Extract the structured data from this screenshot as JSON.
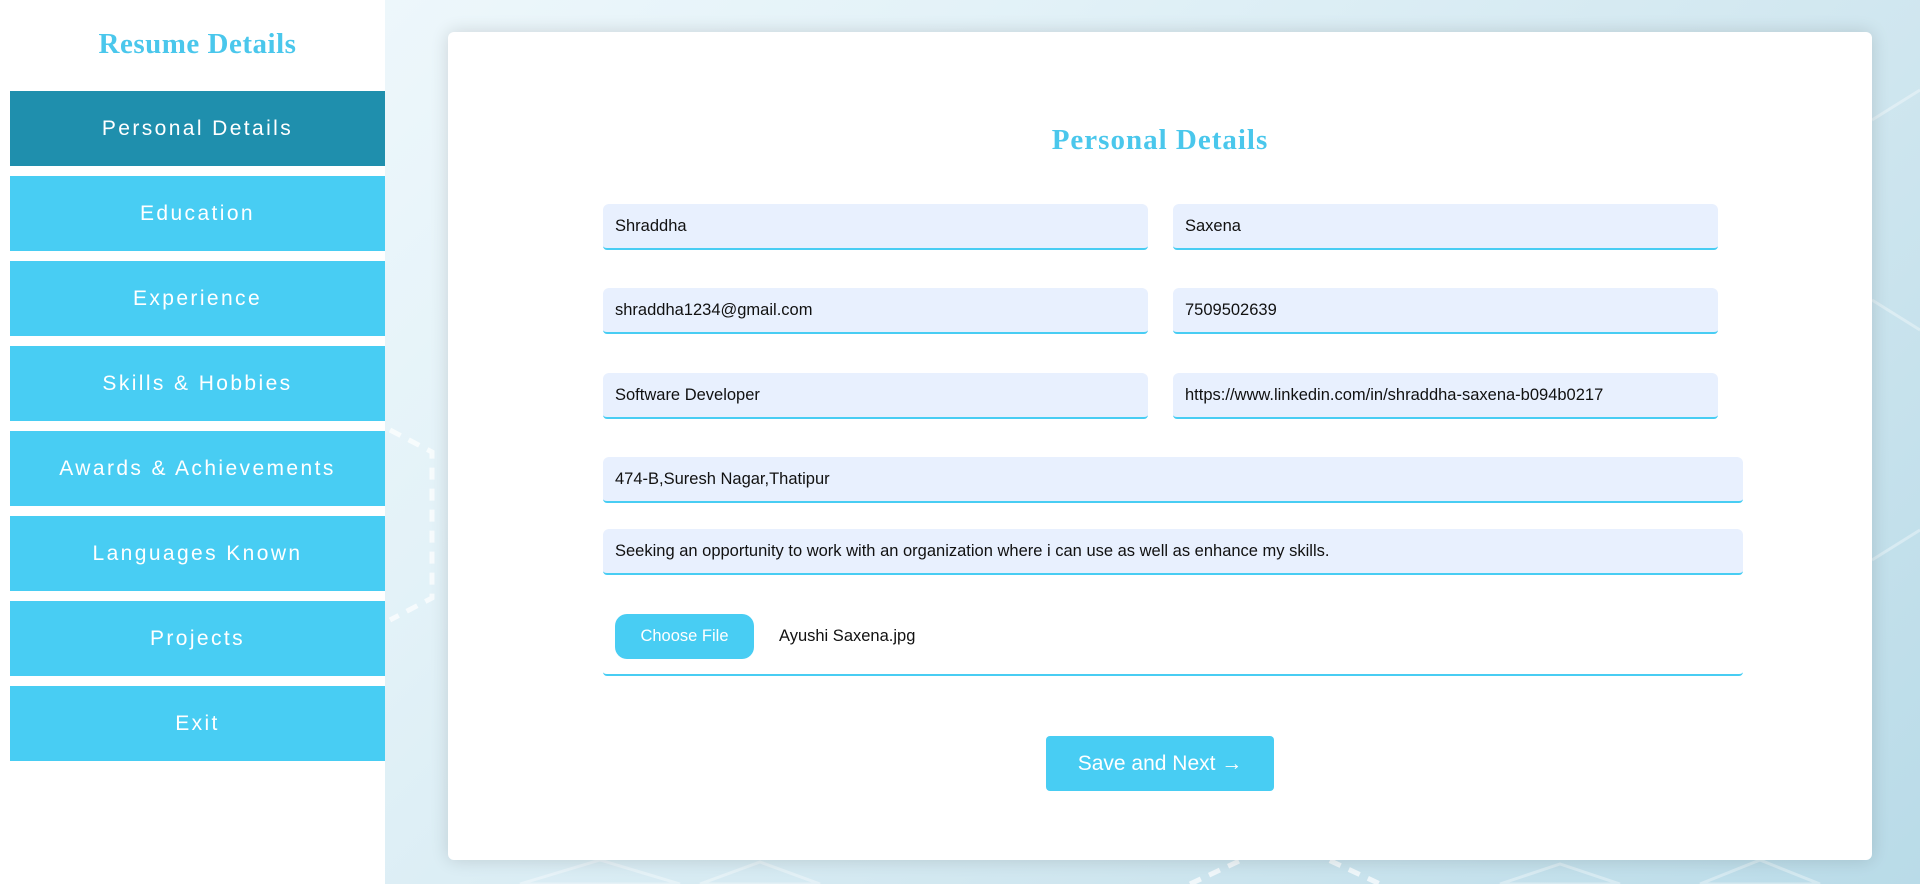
{
  "sidebar": {
    "title": "Resume Details",
    "items": [
      {
        "label": "Personal Details"
      },
      {
        "label": "Education"
      },
      {
        "label": "Experience"
      },
      {
        "label": "Skills & Hobbies"
      },
      {
        "label": "Awards & Achievements"
      },
      {
        "label": "Languages Known"
      },
      {
        "label": "Projects"
      },
      {
        "label": "Exit"
      }
    ],
    "active_index": 0
  },
  "form": {
    "title": "Personal Details",
    "first_name": "Shraddha",
    "last_name": "Saxena",
    "email": "shraddha1234@gmail.com",
    "phone": "7509502639",
    "designation": "Software Developer",
    "linkedin": "https://www.linkedin.com/in/shraddha-saxena-b094b0217",
    "address": "474-B,Suresh Nagar,Thatipur",
    "objective": "Seeking an opportunity to work with an organization where i can use as well as enhance my skills.",
    "file": {
      "button_label": "Choose File",
      "file_name": "Ayushi Saxena.jpg"
    },
    "save_label": "Save and Next →"
  },
  "colors": {
    "accent": "#48cdf3",
    "active_nav": "#1f8fad",
    "title": "#4ac7ec",
    "field_bg": "#e8f0fe"
  }
}
